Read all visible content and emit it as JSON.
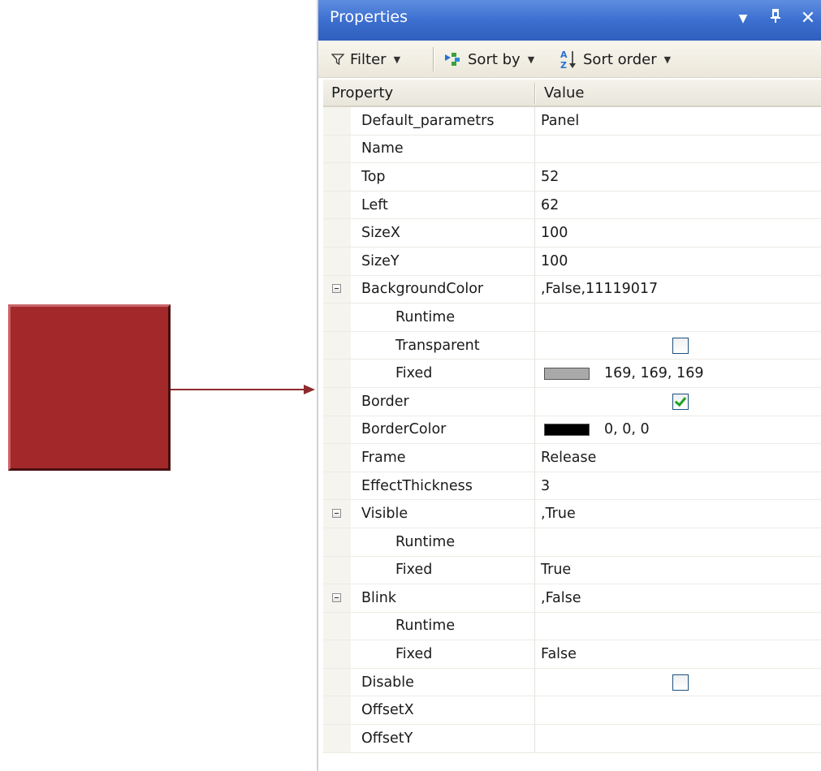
{
  "preview": {
    "panel_color": "#a3282a",
    "arrow_color": "#8f2a2e"
  },
  "window": {
    "title": "Properties",
    "icons": {
      "menu": "dropdown-arrow-icon",
      "pin": "pin-icon",
      "close": "close-icon"
    }
  },
  "toolbar": {
    "filter_label": "Filter",
    "sort_by_label": "Sort by",
    "sort_order_label": "Sort order"
  },
  "grid": {
    "header": {
      "property": "Property",
      "value": "Value"
    },
    "rows": [
      {
        "name": "Default_parametrs",
        "value": "Panel",
        "kind": "text",
        "level": 0
      },
      {
        "name": "Name",
        "value": "",
        "kind": "text",
        "level": 0
      },
      {
        "name": "Top",
        "value": "52",
        "kind": "text",
        "level": 0
      },
      {
        "name": "Left",
        "value": "62",
        "kind": "text",
        "level": 0
      },
      {
        "name": "SizeX",
        "value": "100",
        "kind": "text",
        "level": 0
      },
      {
        "name": "SizeY",
        "value": "100",
        "kind": "text",
        "level": 0
      },
      {
        "name": "BackgroundColor",
        "value": ",False,11119017",
        "kind": "text",
        "level": 0,
        "expanded": true
      },
      {
        "name": "Runtime",
        "value": "",
        "kind": "text",
        "level": 1
      },
      {
        "name": "Transparent",
        "value": "",
        "kind": "checkbox",
        "checked": false,
        "level": 1
      },
      {
        "name": "Fixed",
        "value": "169, 169, 169",
        "kind": "color",
        "color": "#a9a9a9",
        "level": 1
      },
      {
        "name": "Border",
        "value": "",
        "kind": "checkbox",
        "checked": true,
        "level": 0
      },
      {
        "name": "BorderColor",
        "value": "0, 0, 0",
        "kind": "color",
        "color": "#000000",
        "level": 0
      },
      {
        "name": "Frame",
        "value": "Release",
        "kind": "text",
        "level": 0
      },
      {
        "name": "EffectThickness",
        "value": "3",
        "kind": "text",
        "level": 0
      },
      {
        "name": "Visible",
        "value": ",True",
        "kind": "text",
        "level": 0,
        "expanded": true
      },
      {
        "name": "Runtime",
        "value": "",
        "kind": "text",
        "level": 1
      },
      {
        "name": "Fixed",
        "value": "True",
        "kind": "text",
        "level": 1
      },
      {
        "name": "Blink",
        "value": ",False",
        "kind": "text",
        "level": 0,
        "expanded": true
      },
      {
        "name": "Runtime",
        "value": "",
        "kind": "text",
        "level": 1
      },
      {
        "name": "Fixed",
        "value": "False",
        "kind": "text",
        "level": 1
      },
      {
        "name": "Disable",
        "value": "",
        "kind": "checkbox",
        "checked": false,
        "level": 0
      },
      {
        "name": "OffsetX",
        "value": "",
        "kind": "text",
        "level": 0
      },
      {
        "name": "OffsetY",
        "value": "",
        "kind": "text",
        "level": 0
      }
    ]
  }
}
